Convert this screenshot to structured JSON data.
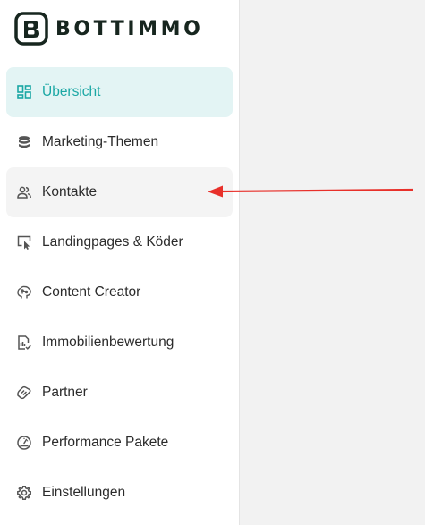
{
  "brand": {
    "name": "BOTTIMMO",
    "color": "#17261f"
  },
  "theme": {
    "accent": "#1aa7a4",
    "active_bg": "#e3f4f4",
    "annotation_color": "#e8302a"
  },
  "sidebar": {
    "items": [
      {
        "label": "Übersicht",
        "icon": "dashboard-icon",
        "state": "active"
      },
      {
        "label": "Marketing-Themen",
        "icon": "database-stack-icon"
      },
      {
        "label": "Kontakte",
        "icon": "people-icon",
        "state": "hover"
      },
      {
        "label": "Landingpages & Köder",
        "icon": "monitor-cursor-icon"
      },
      {
        "label": "Content Creator",
        "icon": "brain-icon"
      },
      {
        "label": "Immobilienbewertung",
        "icon": "report-check-icon"
      },
      {
        "label": "Partner",
        "icon": "handshake-icon"
      },
      {
        "label": "Performance Pakete",
        "icon": "speedometer-icon"
      },
      {
        "label": "Einstellungen",
        "icon": "gear-icon"
      }
    ]
  },
  "annotation": {
    "type": "arrow",
    "points_to": "Kontakte"
  }
}
